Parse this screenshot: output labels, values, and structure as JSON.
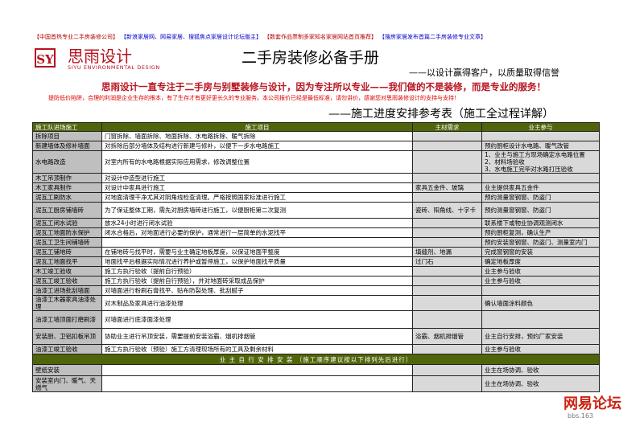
{
  "links": [
    "【中国首热专业二手房装修公司】",
    "【新浪家居网、网易家居、搜狐焦点家居设计论坛版主】",
    "【数套作品票制多家知名家居网站首页推荐】",
    "【搜房家居发布首篇二手房装修专业文章】"
  ],
  "brand": {
    "logo": "SY",
    "name": "思雨设计",
    "name_en": "SIYU ENVIRONMENTAL DESIGN"
  },
  "title": "二手房装修必备手册",
  "slogan": "——以设计赢得客户，以质量取得信誉",
  "intro": "思雨设计一直专注于二手房与别墅装修与设计，因为专注所以专业——我们做的不是装修，而是专业的服务！",
  "warning": "提防低价陷阱，合理的利润是企业生存的根本，有了生存才有更好更长久的专业服务。本公司报价已经是最低标准，请勿讲价，感谢您对思雨装修设计的支持与支持！",
  "subtitle": "——施工进度安排参考表（施工全过程详解）",
  "table": {
    "headers": [
      "施工队进场施工",
      "施工项目",
      "主材需求",
      "业主参与"
    ],
    "rows": [
      {
        "name": "拆除项目",
        "project": "门窗拆除、墙面拆除、地面拆除、水电路拆除、暖气拆除",
        "material": "",
        "owner": ""
      },
      {
        "name": "新建墙体及修补墙面",
        "project": "对拆除后部分墙体及结构进行新建与修补，以便下一步水电路施工",
        "material": "",
        "owner": "预约厨柜设计水电路、暖气改管"
      },
      {
        "name": "水电路改造",
        "project": "对室内所有的水电路根据实际应用需求，修改调整位置",
        "material": "",
        "owner": "1、业主与施工方现场确定水电路位置\n2、材料场验收\n3、水电施工完毕对水路打压验收"
      },
      {
        "name": "木工吊顶制作",
        "project": "对设计中造型进行施工",
        "material": "",
        "owner": ""
      },
      {
        "name": "木工家具制作",
        "project": "对设计中家具进行施工",
        "material": "家具五金件、玻璃",
        "owner": "业主提供家具五金件"
      },
      {
        "name": "泥瓦工刷防水",
        "project": "对地面清理干净尤其对阴角线检查清理。严格按照国家标准进行施工",
        "material": "",
        "owner": "预约测量窗钢窗、防盗门"
      },
      {
        "name": "泥瓦工厨房铺墙砖",
        "project": "为了保证整体工期，需先对厨房墙砖进行施工，以便厨柜第二次复测",
        "material": "瓷砖、阳角线、十字卡",
        "owner": "预约测量窗钢窗、防盗门"
      },
      {
        "name": "泥瓦工闭水试验",
        "project": "放水24小时进行闭水试验",
        "material": "",
        "owner": "联系楼下或物业协调观测闭水"
      },
      {
        "name": "泥瓦工地面防水保护",
        "project": "闭水合格后，对地面进行必要的保护，通常进行一层简单的水泥找平",
        "material": "",
        "owner": "预约厨柜复测，确认生产"
      },
      {
        "name": "泥瓦工卫生间铺墙砖",
        "project": "",
        "material": "",
        "owner": "预约安装窗钢窗、防盗门、测量室内门"
      },
      {
        "name": "泥瓦工铺地砖",
        "project": "在铺地砖与找平时，需要与业主确定地板厚度，以保证地面平整度",
        "material": "填缝剂、地漏",
        "owner": "完成窗钢窗的安装"
      },
      {
        "name": "泥瓦工地面找平",
        "project": "地面找平后根据实际情况进行养护或暂停施工，以保护地面找平质量",
        "material": "过门石",
        "owner": "确定地板厚度"
      },
      {
        "name": "木工竣工验收",
        "project": "施工方执行验收（提前自行预验）",
        "material": "",
        "owner": "业主参与验收"
      },
      {
        "name": "泥瓦工竣工验收",
        "project": "施工方执行验收（提前自行预验），并对地面砖采取成品保护",
        "material": "",
        "owner": "业主参与验收"
      },
      {
        "name": "油漆工进场批刮墙面",
        "project": "对墙面进行粉刷石膏找平、贴布防裂处理、批刮腻子",
        "material": "",
        "owner": ""
      },
      {
        "name": "油漆工木器家具油漆处理",
        "project": "对木制品及家具进行油漆处理",
        "material": "",
        "owner": "确认墙面涂料颜色"
      },
      {
        "name": "油漆工墙顶面打磨刷漆",
        "project": "对墙面进行底漆面漆处理",
        "material": "",
        "owner": ""
      },
      {
        "name": "安装厨、卫铝扣板吊顶",
        "project": "协助业主进行吊顶安装，需要提前安装浴霸、烟机排烟管",
        "material": "浴霸、烟机排烟管",
        "owner": "业主自行安排，预约厂家安装"
      },
      {
        "name": "油漆工竣工验收",
        "project": "施工方执行验收（预验）施工方清理现场所有的工具及剩余材料",
        "material": "",
        "owner": "业主参与验收"
      }
    ],
    "section": "业 主 自 行 安 排 安 装 （施工顺序建议按以下排列先后进行）",
    "rows2": [
      {
        "name": "壁纸安装",
        "project": "",
        "material": "",
        "owner": "业主在场协调、验收"
      },
      {
        "name": "安装室内门、暖气、天燃气",
        "project": "",
        "material": "",
        "owner": "业主在场协调、验收"
      }
    ]
  },
  "watermark": {
    "text": "网易论坛",
    "sub": "bbs.163"
  }
}
